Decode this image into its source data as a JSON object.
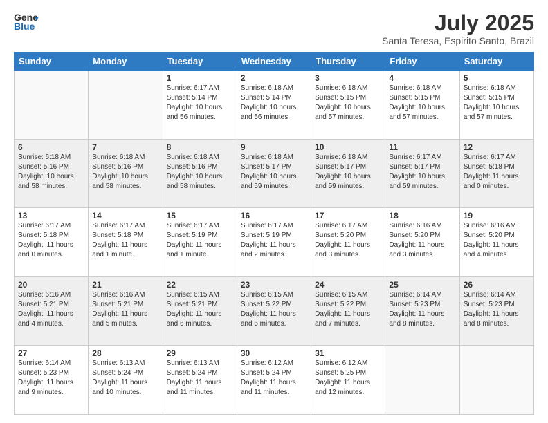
{
  "header": {
    "logo_general": "General",
    "logo_blue": "Blue",
    "month_year": "July 2025",
    "location": "Santa Teresa, Espirito Santo, Brazil"
  },
  "days_of_week": [
    "Sunday",
    "Monday",
    "Tuesday",
    "Wednesday",
    "Thursday",
    "Friday",
    "Saturday"
  ],
  "weeks": [
    [
      {
        "day": "",
        "sunrise": "",
        "sunset": "",
        "daylight": ""
      },
      {
        "day": "",
        "sunrise": "",
        "sunset": "",
        "daylight": ""
      },
      {
        "day": "1",
        "sunrise": "Sunrise: 6:17 AM",
        "sunset": "Sunset: 5:14 PM",
        "daylight": "Daylight: 10 hours and 56 minutes."
      },
      {
        "day": "2",
        "sunrise": "Sunrise: 6:18 AM",
        "sunset": "Sunset: 5:14 PM",
        "daylight": "Daylight: 10 hours and 56 minutes."
      },
      {
        "day": "3",
        "sunrise": "Sunrise: 6:18 AM",
        "sunset": "Sunset: 5:15 PM",
        "daylight": "Daylight: 10 hours and 57 minutes."
      },
      {
        "day": "4",
        "sunrise": "Sunrise: 6:18 AM",
        "sunset": "Sunset: 5:15 PM",
        "daylight": "Daylight: 10 hours and 57 minutes."
      },
      {
        "day": "5",
        "sunrise": "Sunrise: 6:18 AM",
        "sunset": "Sunset: 5:15 PM",
        "daylight": "Daylight: 10 hours and 57 minutes."
      }
    ],
    [
      {
        "day": "6",
        "sunrise": "Sunrise: 6:18 AM",
        "sunset": "Sunset: 5:16 PM",
        "daylight": "Daylight: 10 hours and 58 minutes."
      },
      {
        "day": "7",
        "sunrise": "Sunrise: 6:18 AM",
        "sunset": "Sunset: 5:16 PM",
        "daylight": "Daylight: 10 hours and 58 minutes."
      },
      {
        "day": "8",
        "sunrise": "Sunrise: 6:18 AM",
        "sunset": "Sunset: 5:16 PM",
        "daylight": "Daylight: 10 hours and 58 minutes."
      },
      {
        "day": "9",
        "sunrise": "Sunrise: 6:18 AM",
        "sunset": "Sunset: 5:17 PM",
        "daylight": "Daylight: 10 hours and 59 minutes."
      },
      {
        "day": "10",
        "sunrise": "Sunrise: 6:18 AM",
        "sunset": "Sunset: 5:17 PM",
        "daylight": "Daylight: 10 hours and 59 minutes."
      },
      {
        "day": "11",
        "sunrise": "Sunrise: 6:17 AM",
        "sunset": "Sunset: 5:17 PM",
        "daylight": "Daylight: 10 hours and 59 minutes."
      },
      {
        "day": "12",
        "sunrise": "Sunrise: 6:17 AM",
        "sunset": "Sunset: 5:18 PM",
        "daylight": "Daylight: 11 hours and 0 minutes."
      }
    ],
    [
      {
        "day": "13",
        "sunrise": "Sunrise: 6:17 AM",
        "sunset": "Sunset: 5:18 PM",
        "daylight": "Daylight: 11 hours and 0 minutes."
      },
      {
        "day": "14",
        "sunrise": "Sunrise: 6:17 AM",
        "sunset": "Sunset: 5:18 PM",
        "daylight": "Daylight: 11 hours and 1 minute."
      },
      {
        "day": "15",
        "sunrise": "Sunrise: 6:17 AM",
        "sunset": "Sunset: 5:19 PM",
        "daylight": "Daylight: 11 hours and 1 minute."
      },
      {
        "day": "16",
        "sunrise": "Sunrise: 6:17 AM",
        "sunset": "Sunset: 5:19 PM",
        "daylight": "Daylight: 11 hours and 2 minutes."
      },
      {
        "day": "17",
        "sunrise": "Sunrise: 6:17 AM",
        "sunset": "Sunset: 5:20 PM",
        "daylight": "Daylight: 11 hours and 3 minutes."
      },
      {
        "day": "18",
        "sunrise": "Sunrise: 6:16 AM",
        "sunset": "Sunset: 5:20 PM",
        "daylight": "Daylight: 11 hours and 3 minutes."
      },
      {
        "day": "19",
        "sunrise": "Sunrise: 6:16 AM",
        "sunset": "Sunset: 5:20 PM",
        "daylight": "Daylight: 11 hours and 4 minutes."
      }
    ],
    [
      {
        "day": "20",
        "sunrise": "Sunrise: 6:16 AM",
        "sunset": "Sunset: 5:21 PM",
        "daylight": "Daylight: 11 hours and 4 minutes."
      },
      {
        "day": "21",
        "sunrise": "Sunrise: 6:16 AM",
        "sunset": "Sunset: 5:21 PM",
        "daylight": "Daylight: 11 hours and 5 minutes."
      },
      {
        "day": "22",
        "sunrise": "Sunrise: 6:15 AM",
        "sunset": "Sunset: 5:21 PM",
        "daylight": "Daylight: 11 hours and 6 minutes."
      },
      {
        "day": "23",
        "sunrise": "Sunrise: 6:15 AM",
        "sunset": "Sunset: 5:22 PM",
        "daylight": "Daylight: 11 hours and 6 minutes."
      },
      {
        "day": "24",
        "sunrise": "Sunrise: 6:15 AM",
        "sunset": "Sunset: 5:22 PM",
        "daylight": "Daylight: 11 hours and 7 minutes."
      },
      {
        "day": "25",
        "sunrise": "Sunrise: 6:14 AM",
        "sunset": "Sunset: 5:23 PM",
        "daylight": "Daylight: 11 hours and 8 minutes."
      },
      {
        "day": "26",
        "sunrise": "Sunrise: 6:14 AM",
        "sunset": "Sunset: 5:23 PM",
        "daylight": "Daylight: 11 hours and 8 minutes."
      }
    ],
    [
      {
        "day": "27",
        "sunrise": "Sunrise: 6:14 AM",
        "sunset": "Sunset: 5:23 PM",
        "daylight": "Daylight: 11 hours and 9 minutes."
      },
      {
        "day": "28",
        "sunrise": "Sunrise: 6:13 AM",
        "sunset": "Sunset: 5:24 PM",
        "daylight": "Daylight: 11 hours and 10 minutes."
      },
      {
        "day": "29",
        "sunrise": "Sunrise: 6:13 AM",
        "sunset": "Sunset: 5:24 PM",
        "daylight": "Daylight: 11 hours and 11 minutes."
      },
      {
        "day": "30",
        "sunrise": "Sunrise: 6:12 AM",
        "sunset": "Sunset: 5:24 PM",
        "daylight": "Daylight: 11 hours and 11 minutes."
      },
      {
        "day": "31",
        "sunrise": "Sunrise: 6:12 AM",
        "sunset": "Sunset: 5:25 PM",
        "daylight": "Daylight: 11 hours and 12 minutes."
      },
      {
        "day": "",
        "sunrise": "",
        "sunset": "",
        "daylight": ""
      },
      {
        "day": "",
        "sunrise": "",
        "sunset": "",
        "daylight": ""
      }
    ]
  ]
}
